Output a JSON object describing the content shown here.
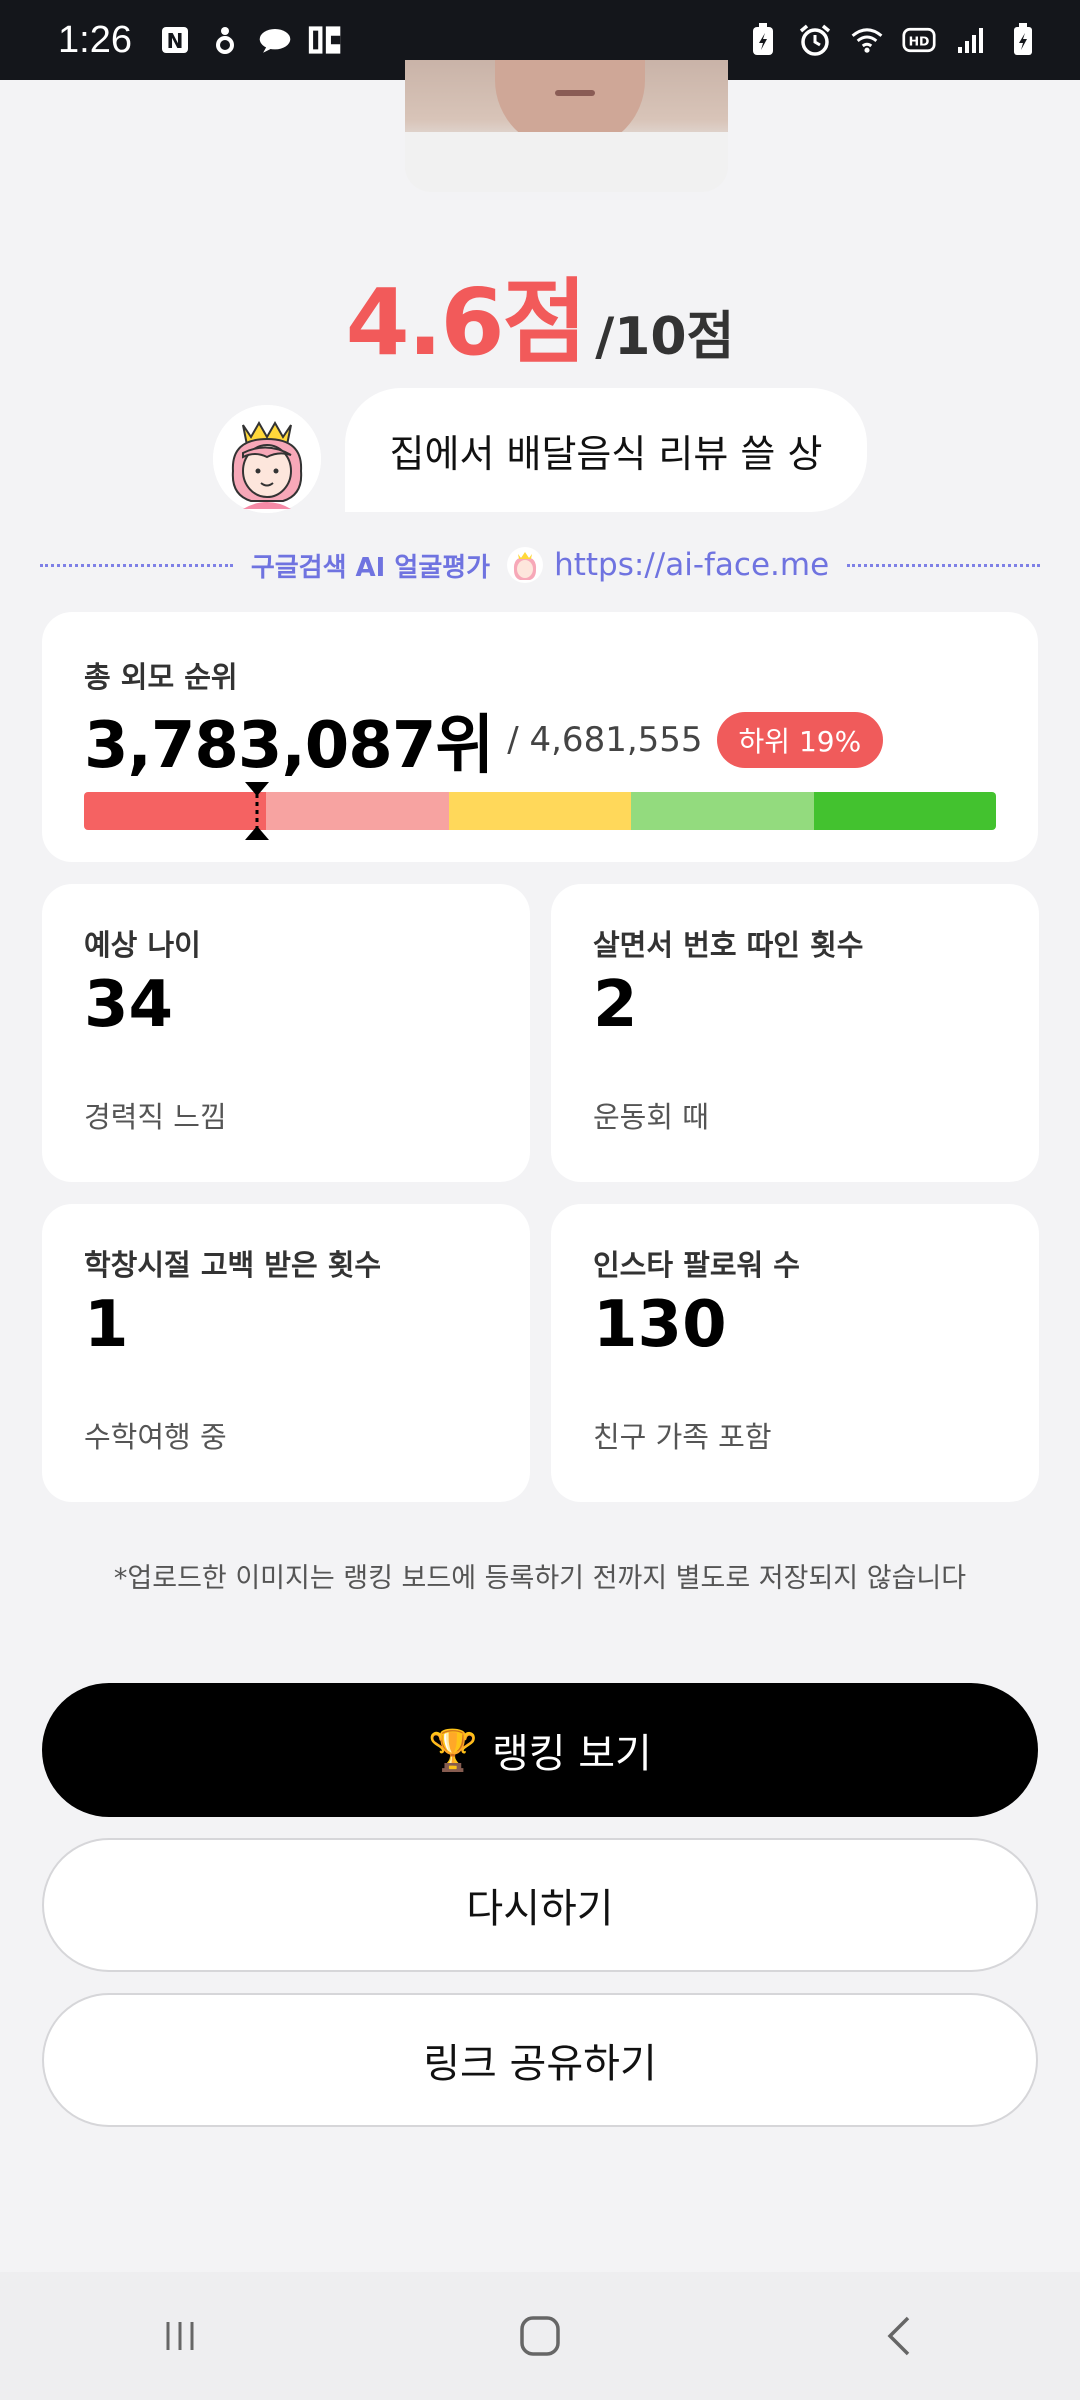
{
  "status_bar": {
    "time": "1:26",
    "left_icons": [
      "notion-icon",
      "threads-icon",
      "cloud-chat-icon",
      "app-logo-icon"
    ],
    "right_icons": [
      "battery-saver-icon",
      "alarm-icon",
      "wifi-icon",
      "hd-icon",
      "signal-icon",
      "battery-icon"
    ]
  },
  "score": {
    "value": "4.6점",
    "total": "/10점"
  },
  "bubble": {
    "text": "집에서 배달음식 리뷰 쓸 상"
  },
  "divider": {
    "text": "구글검색 AI 얼굴평가",
    "url": "https://ai-face.me"
  },
  "rank": {
    "label": "총 외모 순위",
    "value": "3,783,087위",
    "total": "/ 4,681,555",
    "badge": "하위 19%",
    "segment_colors": [
      "#f56262",
      "#f7a3a1",
      "#ffd85a",
      "#93db7e",
      "#43c22f"
    ],
    "marker_fraction": 0.19
  },
  "stats": [
    {
      "label": "예상 나이",
      "value": "34",
      "note": "경력직 느낌"
    },
    {
      "label": "살면서 번호 따인 횟수",
      "value": "2",
      "note": "운동회 때"
    },
    {
      "label": "학창시절 고백 받은 횟수",
      "value": "1",
      "note": "수학여행 중"
    },
    {
      "label": "인스타 팔로워 수",
      "value": "130",
      "note": "친구 가족 포함"
    }
  ],
  "disclaimer": "*업로드한 이미지는 랭킹 보드에 등록하기 전까지 별도로 저장되지 않습니다",
  "buttons": {
    "ranking": "랭킹 보기",
    "retry": "다시하기",
    "share": "링크 공유하기"
  },
  "colors": {
    "accent": "#f25a5a",
    "link": "#6f73e0"
  },
  "nav": {
    "icons": [
      "recent-apps-icon",
      "home-icon",
      "back-icon"
    ]
  }
}
